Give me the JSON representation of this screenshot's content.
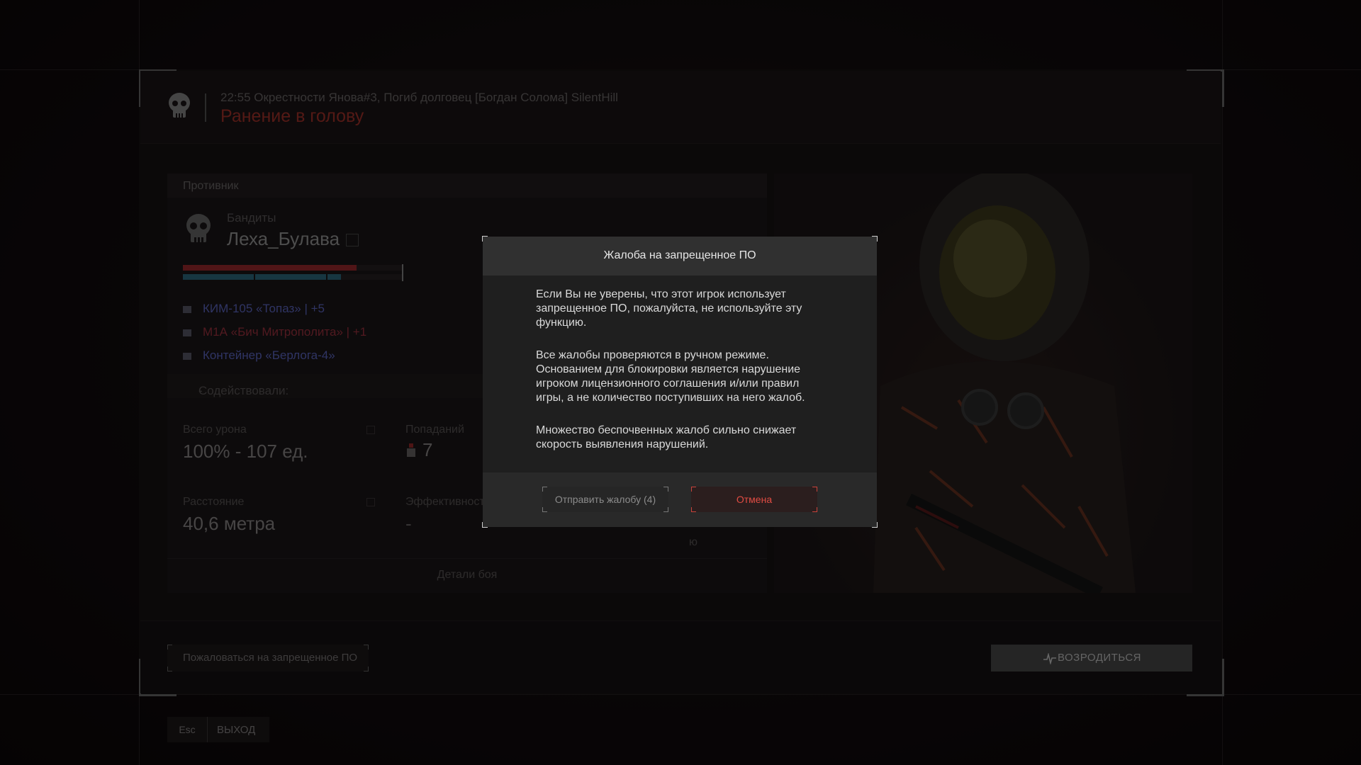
{
  "header": {
    "event": "22:55 Окрестности Янова#3, Погиб долговец [Богдан Солома] SilentHill",
    "cause": "Ранение в голову"
  },
  "enemy": {
    "section_label": "Противник",
    "faction": "Бандиты",
    "name": "Леха_Булава",
    "health_fraction": 0.79,
    "armor_fraction": 0.72,
    "items": [
      {
        "label": "КИМ-105 «Топаз» | +5",
        "color": "#5f69c8",
        "icon": "armor-icon"
      },
      {
        "label": "М1А «Бич Митрополита» | +1",
        "color": "#a23340",
        "icon": "rifle-icon"
      },
      {
        "label": "Контейнер «Берлога-4»",
        "color": "#5f69c8",
        "icon": "container-icon"
      }
    ],
    "assisted_label": "Содействовали:",
    "assisted_value": "-",
    "stats": {
      "total_damage_label": "Всего урона",
      "total_damage_value": "100% - 107 ед.",
      "hits_label": "Попаданий",
      "hits_value": "7",
      "distance_label": "Расстояние",
      "distance_value": "40,6 метра",
      "efficiency_label": "Эффективность",
      "efficiency_value": "-"
    },
    "partial_label": "ю",
    "details_label": "Детали боя"
  },
  "footer": {
    "report_label": "Пожаловаться на запрещенное ПО",
    "respawn_label": "ВОЗРОДИТЬСЯ",
    "esc_key": "Esc",
    "exit_label": "ВЫХОД"
  },
  "modal": {
    "title": "Жалоба на запрещенное ПО",
    "paragraphs": [
      "Если Вы не уверены, что этот игрок использует запрещенное ПО, пожалуйста, не используйте эту функцию.",
      "Все жалобы проверяются в ручном режиме. Основанием для блокировки является нарушение игроком лицензионного соглашения и/или правил игры, а не количество поступивших на него жалоб.",
      "Множество беспочвенных жалоб сильно снижает скорость выявления нарушений."
    ],
    "send_label": "Отправить жалобу (4)",
    "cancel_label": "Отмена"
  },
  "colors": {
    "accent_red": "#a9322b",
    "health": "#a12a2f",
    "armor": "#2f6c82",
    "cancel_text": "#e14c43"
  }
}
